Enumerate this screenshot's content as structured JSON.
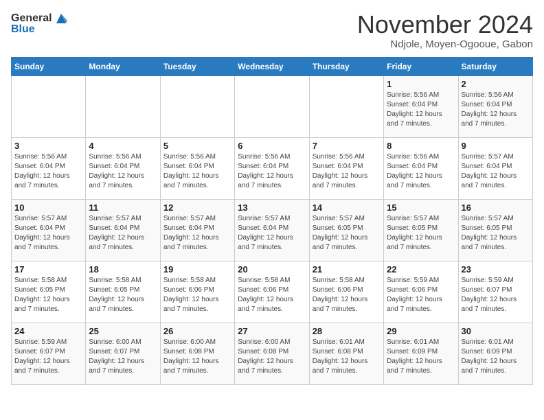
{
  "logo": {
    "general": "General",
    "blue": "Blue"
  },
  "title": "November 2024",
  "subtitle": "Ndjole, Moyen-Ogooue, Gabon",
  "days_of_week": [
    "Sunday",
    "Monday",
    "Tuesday",
    "Wednesday",
    "Thursday",
    "Friday",
    "Saturday"
  ],
  "weeks": [
    [
      null,
      null,
      null,
      null,
      null,
      {
        "day": "1",
        "sunrise": "Sunrise: 5:56 AM",
        "sunset": "Sunset: 6:04 PM",
        "daylight": "Daylight: 12 hours and 7 minutes."
      },
      {
        "day": "2",
        "sunrise": "Sunrise: 5:56 AM",
        "sunset": "Sunset: 6:04 PM",
        "daylight": "Daylight: 12 hours and 7 minutes."
      }
    ],
    [
      {
        "day": "3",
        "sunrise": "Sunrise: 5:56 AM",
        "sunset": "Sunset: 6:04 PM",
        "daylight": "Daylight: 12 hours and 7 minutes."
      },
      {
        "day": "4",
        "sunrise": "Sunrise: 5:56 AM",
        "sunset": "Sunset: 6:04 PM",
        "daylight": "Daylight: 12 hours and 7 minutes."
      },
      {
        "day": "5",
        "sunrise": "Sunrise: 5:56 AM",
        "sunset": "Sunset: 6:04 PM",
        "daylight": "Daylight: 12 hours and 7 minutes."
      },
      {
        "day": "6",
        "sunrise": "Sunrise: 5:56 AM",
        "sunset": "Sunset: 6:04 PM",
        "daylight": "Daylight: 12 hours and 7 minutes."
      },
      {
        "day": "7",
        "sunrise": "Sunrise: 5:56 AM",
        "sunset": "Sunset: 6:04 PM",
        "daylight": "Daylight: 12 hours and 7 minutes."
      },
      {
        "day": "8",
        "sunrise": "Sunrise: 5:56 AM",
        "sunset": "Sunset: 6:04 PM",
        "daylight": "Daylight: 12 hours and 7 minutes."
      },
      {
        "day": "9",
        "sunrise": "Sunrise: 5:57 AM",
        "sunset": "Sunset: 6:04 PM",
        "daylight": "Daylight: 12 hours and 7 minutes."
      }
    ],
    [
      {
        "day": "10",
        "sunrise": "Sunrise: 5:57 AM",
        "sunset": "Sunset: 6:04 PM",
        "daylight": "Daylight: 12 hours and 7 minutes."
      },
      {
        "day": "11",
        "sunrise": "Sunrise: 5:57 AM",
        "sunset": "Sunset: 6:04 PM",
        "daylight": "Daylight: 12 hours and 7 minutes."
      },
      {
        "day": "12",
        "sunrise": "Sunrise: 5:57 AM",
        "sunset": "Sunset: 6:04 PM",
        "daylight": "Daylight: 12 hours and 7 minutes."
      },
      {
        "day": "13",
        "sunrise": "Sunrise: 5:57 AM",
        "sunset": "Sunset: 6:04 PM",
        "daylight": "Daylight: 12 hours and 7 minutes."
      },
      {
        "day": "14",
        "sunrise": "Sunrise: 5:57 AM",
        "sunset": "Sunset: 6:05 PM",
        "daylight": "Daylight: 12 hours and 7 minutes."
      },
      {
        "day": "15",
        "sunrise": "Sunrise: 5:57 AM",
        "sunset": "Sunset: 6:05 PM",
        "daylight": "Daylight: 12 hours and 7 minutes."
      },
      {
        "day": "16",
        "sunrise": "Sunrise: 5:57 AM",
        "sunset": "Sunset: 6:05 PM",
        "daylight": "Daylight: 12 hours and 7 minutes."
      }
    ],
    [
      {
        "day": "17",
        "sunrise": "Sunrise: 5:58 AM",
        "sunset": "Sunset: 6:05 PM",
        "daylight": "Daylight: 12 hours and 7 minutes."
      },
      {
        "day": "18",
        "sunrise": "Sunrise: 5:58 AM",
        "sunset": "Sunset: 6:05 PM",
        "daylight": "Daylight: 12 hours and 7 minutes."
      },
      {
        "day": "19",
        "sunrise": "Sunrise: 5:58 AM",
        "sunset": "Sunset: 6:06 PM",
        "daylight": "Daylight: 12 hours and 7 minutes."
      },
      {
        "day": "20",
        "sunrise": "Sunrise: 5:58 AM",
        "sunset": "Sunset: 6:06 PM",
        "daylight": "Daylight: 12 hours and 7 minutes."
      },
      {
        "day": "21",
        "sunrise": "Sunrise: 5:58 AM",
        "sunset": "Sunset: 6:06 PM",
        "daylight": "Daylight: 12 hours and 7 minutes."
      },
      {
        "day": "22",
        "sunrise": "Sunrise: 5:59 AM",
        "sunset": "Sunset: 6:06 PM",
        "daylight": "Daylight: 12 hours and 7 minutes."
      },
      {
        "day": "23",
        "sunrise": "Sunrise: 5:59 AM",
        "sunset": "Sunset: 6:07 PM",
        "daylight": "Daylight: 12 hours and 7 minutes."
      }
    ],
    [
      {
        "day": "24",
        "sunrise": "Sunrise: 5:59 AM",
        "sunset": "Sunset: 6:07 PM",
        "daylight": "Daylight: 12 hours and 7 minutes."
      },
      {
        "day": "25",
        "sunrise": "Sunrise: 6:00 AM",
        "sunset": "Sunset: 6:07 PM",
        "daylight": "Daylight: 12 hours and 7 minutes."
      },
      {
        "day": "26",
        "sunrise": "Sunrise: 6:00 AM",
        "sunset": "Sunset: 6:08 PM",
        "daylight": "Daylight: 12 hours and 7 minutes."
      },
      {
        "day": "27",
        "sunrise": "Sunrise: 6:00 AM",
        "sunset": "Sunset: 6:08 PM",
        "daylight": "Daylight: 12 hours and 7 minutes."
      },
      {
        "day": "28",
        "sunrise": "Sunrise: 6:01 AM",
        "sunset": "Sunset: 6:08 PM",
        "daylight": "Daylight: 12 hours and 7 minutes."
      },
      {
        "day": "29",
        "sunrise": "Sunrise: 6:01 AM",
        "sunset": "Sunset: 6:09 PM",
        "daylight": "Daylight: 12 hours and 7 minutes."
      },
      {
        "day": "30",
        "sunrise": "Sunrise: 6:01 AM",
        "sunset": "Sunset: 6:09 PM",
        "daylight": "Daylight: 12 hours and 7 minutes."
      }
    ]
  ]
}
